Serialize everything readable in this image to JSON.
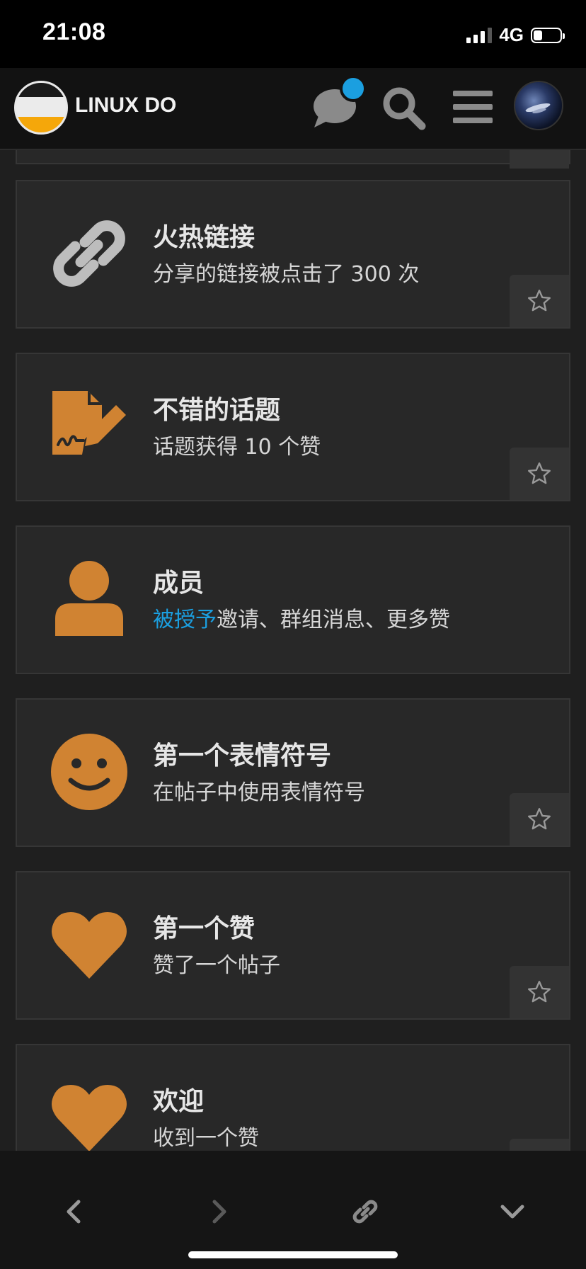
{
  "status_bar": {
    "time": "21:08",
    "network": "4G",
    "signal_bars": 4,
    "battery_level": 0.25
  },
  "header": {
    "site_title": "LINUX DO",
    "icons": [
      "chat-icon",
      "search-icon",
      "menu-icon"
    ],
    "notification_dot_color": "#1b9fe0"
  },
  "badges": [
    {
      "title": "火热链接",
      "description": "分享的链接被点击了 300 次",
      "icon": "link-icon",
      "icon_color": "#bdbdbd",
      "has_star": true
    },
    {
      "title": "不错的话题",
      "description": "话题获得 10 个赞",
      "icon": "signed-document-icon",
      "icon_color": "#d08332",
      "has_star": true
    },
    {
      "title": "成员",
      "description_prefix": "被授予",
      "description": "邀请、群组消息、更多赞",
      "icon": "user-icon",
      "icon_color": "#d08332",
      "has_star": false
    },
    {
      "title": "第一个表情符号",
      "description": "在帖子中使用表情符号",
      "icon": "smile-icon",
      "icon_color": "#d08332",
      "has_star": true
    },
    {
      "title": "第一个赞",
      "description": "赞了一个帖子",
      "icon": "heart-icon",
      "icon_color": "#d08332",
      "has_star": true
    },
    {
      "title": "欢迎",
      "description": "收到一个赞",
      "icon": "heart-icon",
      "icon_color": "#d08332",
      "has_star": true
    }
  ],
  "toolbar": {
    "buttons": [
      "back-icon",
      "forward-icon",
      "share-link-icon",
      "collapse-icon"
    ]
  },
  "colors": {
    "accent": "#1b9fe0",
    "badge_icon": "#d08332",
    "card_bg": "#282828"
  }
}
